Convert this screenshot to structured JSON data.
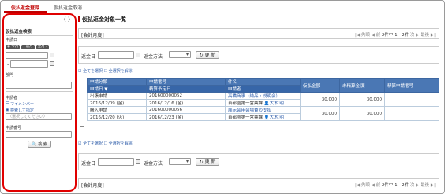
{
  "tabs": {
    "register": "仮払返金登録",
    "cancel": "仮払返金取消"
  },
  "side": {
    "nav": "〈 〉",
    "title": "仮払返金検索",
    "date_label": "申請日",
    "today": "今月",
    "prev_month": "前月",
    "next_month": "翌月",
    "tilde": "〜",
    "dept_label": "部門",
    "applicant_label": "申請者",
    "my_member": "マイメンバー",
    "search_specify": "検索して指定",
    "select_placeholder": "〈選択してください〉",
    "app_no_label": "申請番号",
    "search_button": "検 索"
  },
  "main": {
    "title": "仮払返金対象一覧",
    "fiscal": "[会計月度]",
    "pager": {
      "first": "先頭",
      "prev": "前",
      "count": "2件中 1 - 2件",
      "next": "次",
      "last": "最後"
    },
    "refund_date": "返金日",
    "refund_method": "返金方法",
    "update": "更 新",
    "select_all": "全てを選択",
    "deselect_all": "全選択を解除",
    "headers": {
      "type": "申請分類",
      "app_no": "申請番号",
      "subject": "件名",
      "advance": "仮払金額",
      "unsettled": "未精算金額",
      "settle_no": "精算申請番号",
      "app_date": "申請日 ▼",
      "settle_date": "精算予定日",
      "applicant": "申請者"
    },
    "rows": [
      {
        "type": "出張申請",
        "app_no": "201600000052",
        "subject": "高橋商事（納品・説明会）",
        "advance": "30,000",
        "unsettled": "30,000",
        "settle_no": "",
        "app_date": "2016/12/09 (金)",
        "settle_date": "2016/12/16 (金)",
        "dept": "首都圏第一営業課",
        "applicant": "大木 明"
      },
      {
        "type": "購入申請",
        "app_no": "201600000056",
        "subject": "展示会用会場費の支払",
        "advance": "30,000",
        "unsettled": "30,000",
        "settle_no": "",
        "app_date": "2016/12/20 (火)",
        "settle_date": "2016/12/23 (金)",
        "dept": "首都圏第一営業課",
        "applicant": "大木 明"
      }
    ]
  }
}
